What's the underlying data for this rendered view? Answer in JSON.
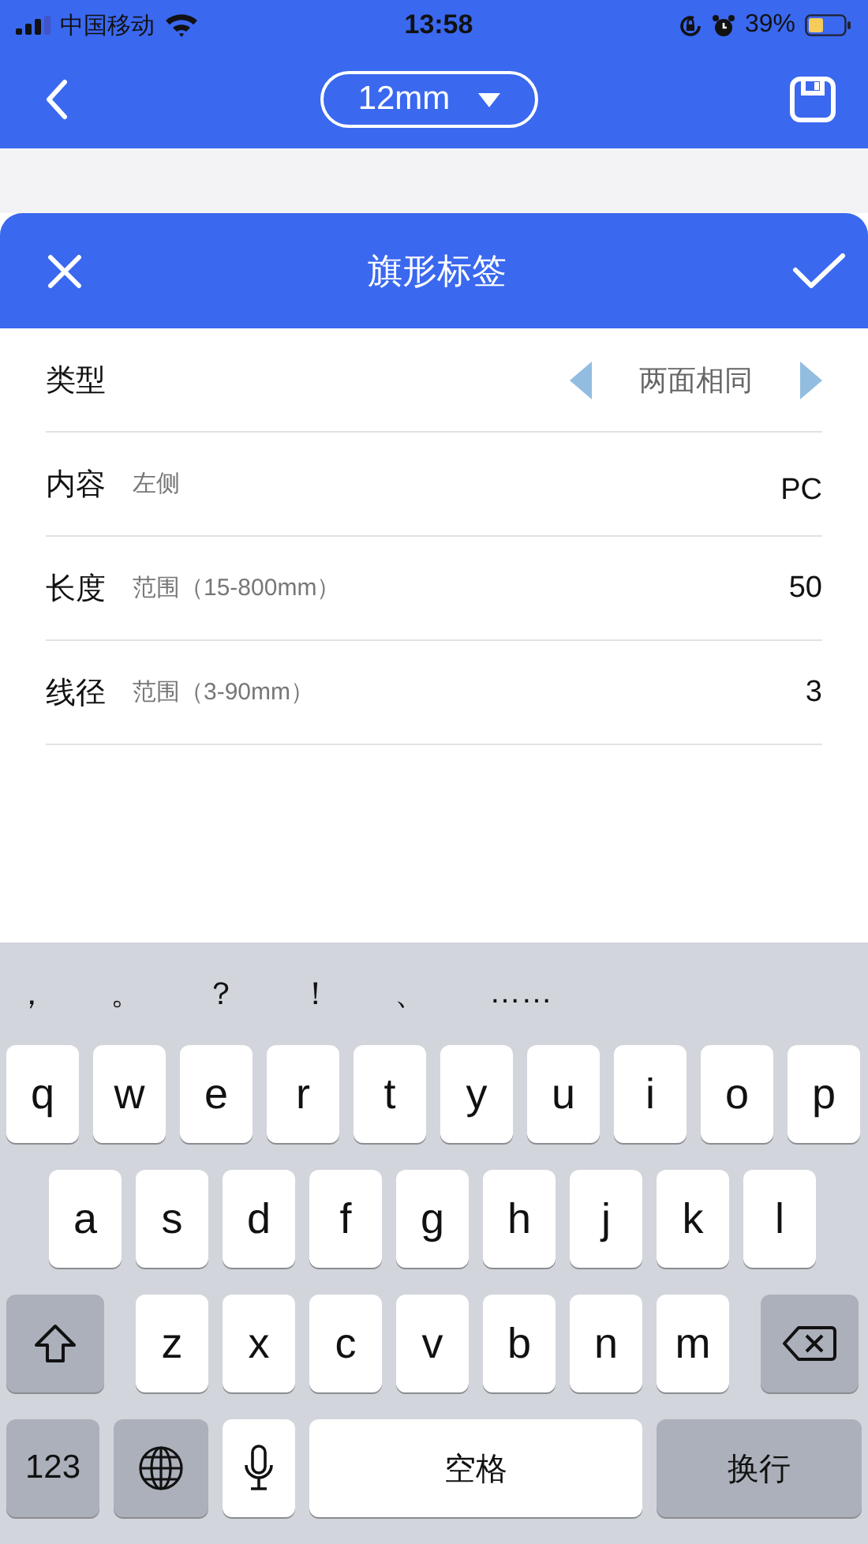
{
  "status_bar": {
    "carrier": "中国移动",
    "time": "13:58",
    "battery": "39%"
  },
  "nav": {
    "size": "12mm"
  },
  "sheet": {
    "title": "旗形标签",
    "rows": [
      {
        "kind": "picker",
        "label": "类型",
        "value": "两面相同"
      },
      {
        "kind": "field",
        "label": "内容",
        "hint": "左侧",
        "value": "PC"
      },
      {
        "kind": "field",
        "label": "长度",
        "hint": "范围（15-800mm）",
        "value": "50"
      },
      {
        "kind": "field",
        "label": "线径",
        "hint": "范围（3-90mm）",
        "value": "3"
      }
    ]
  },
  "keyboard": {
    "suggestions": [
      "，",
      "。",
      "？",
      "！",
      "、",
      "……"
    ],
    "rows": [
      [
        "q",
        "w",
        "e",
        "r",
        "t",
        "y",
        "u",
        "i",
        "o",
        "p"
      ],
      [
        "a",
        "s",
        "d",
        "f",
        "g",
        "h",
        "j",
        "k",
        "l"
      ],
      [
        "z",
        "x",
        "c",
        "v",
        "b",
        "n",
        "m"
      ]
    ],
    "numbers": "123",
    "space": "空格",
    "return": "换行"
  }
}
